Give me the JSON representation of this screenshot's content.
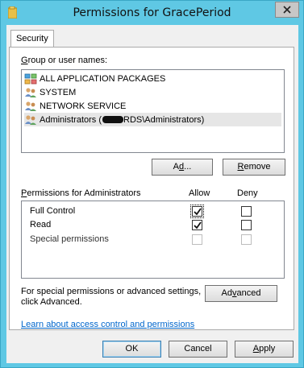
{
  "window": {
    "title": "Permissions for GracePeriod"
  },
  "tabs": [
    {
      "label": "Security"
    }
  ],
  "group_section": {
    "label_prefix": "G",
    "label_rest": "roup or user names:",
    "users": [
      {
        "name": "ALL APPLICATION PACKAGES",
        "icon": "app-packages-icon"
      },
      {
        "name": "SYSTEM",
        "icon": "users-icon"
      },
      {
        "name": "NETWORK SERVICE",
        "icon": "users-icon"
      },
      {
        "name_prefix": "Administrators (",
        "name_suffix": "RDS\\Administrators)",
        "icon": "users-icon",
        "selected": true
      }
    ],
    "add_button": {
      "accel": "d",
      "pre": "A",
      "post": "..."
    },
    "remove_button": {
      "accel": "R",
      "post": "emove"
    }
  },
  "permissions": {
    "label_pre": "",
    "label_accel": "P",
    "label_post": "ermissions for Administrators",
    "allow_header": "Allow",
    "deny_header": "Deny",
    "rows": [
      {
        "name": "Full Control",
        "allow": true,
        "deny": false,
        "enabled": true,
        "focused": true
      },
      {
        "name": "Read",
        "allow": true,
        "deny": false,
        "enabled": true
      },
      {
        "name": "Special permissions",
        "allow": false,
        "deny": false,
        "enabled": false
      }
    ]
  },
  "advanced": {
    "text_line1": "For special permissions or advanced settings,",
    "text_line2": "click Advanced.",
    "button_pre": "Ad",
    "button_accel": "v",
    "button_post": "anced"
  },
  "help_link": "Learn about access control and permissions",
  "footer": {
    "ok": "OK",
    "cancel": "Cancel",
    "apply_accel": "A",
    "apply_post": "pply"
  },
  "colors": {
    "title_bar": "#5fc8e4",
    "link": "#0066cc",
    "selection": "#e6e6e6"
  }
}
